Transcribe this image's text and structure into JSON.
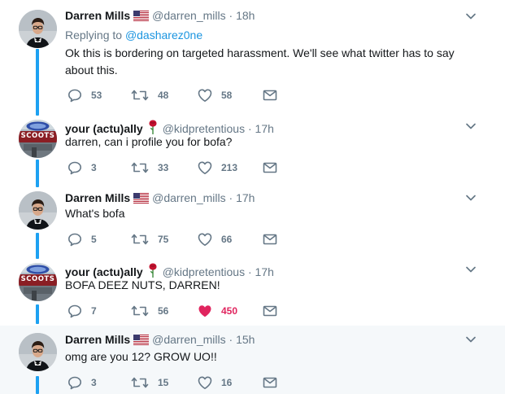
{
  "replying_prefix": "Replying to ",
  "replying_handle": "@dasharez0ne",
  "tweets": [
    {
      "name": "Darren Mills",
      "handle": "@darren_mills",
      "time": "18h",
      "text": "Ok this is bordering on targeted harassment. We'll see what twitter has to say about this.",
      "replies": "53",
      "retweets": "48",
      "likes": "58",
      "liked": false
    },
    {
      "name": "your (actu)ally",
      "handle": "@kidpretentious",
      "time": "17h",
      "avatar_text": "SCOOTS",
      "text": "darren, can i profile you for bofa?",
      "replies": "3",
      "retweets": "33",
      "likes": "213",
      "liked": false
    },
    {
      "name": "Darren Mills",
      "handle": "@darren_mills",
      "time": "17h",
      "text": "What's bofa",
      "replies": "5",
      "retweets": "75",
      "likes": "66",
      "liked": false
    },
    {
      "name": "your (actu)ally",
      "handle": "@kidpretentious",
      "time": "17h",
      "avatar_text": "SCOOTS",
      "text": "BOFA DEEZ NUTS, DARREN!",
      "replies": "7",
      "retweets": "56",
      "likes": "450",
      "liked": true
    },
    {
      "name": "Darren Mills",
      "handle": "@darren_mills",
      "time": "15h",
      "text": "omg are you 12? GROW UO!!",
      "replies": "3",
      "retweets": "15",
      "likes": "16",
      "liked": false
    }
  ],
  "colors": {
    "accent": "#1da1f2",
    "link": "#1b95e0",
    "muted": "#657786",
    "like": "#e0245e",
    "highlight_bg": "#f5f8fa"
  }
}
